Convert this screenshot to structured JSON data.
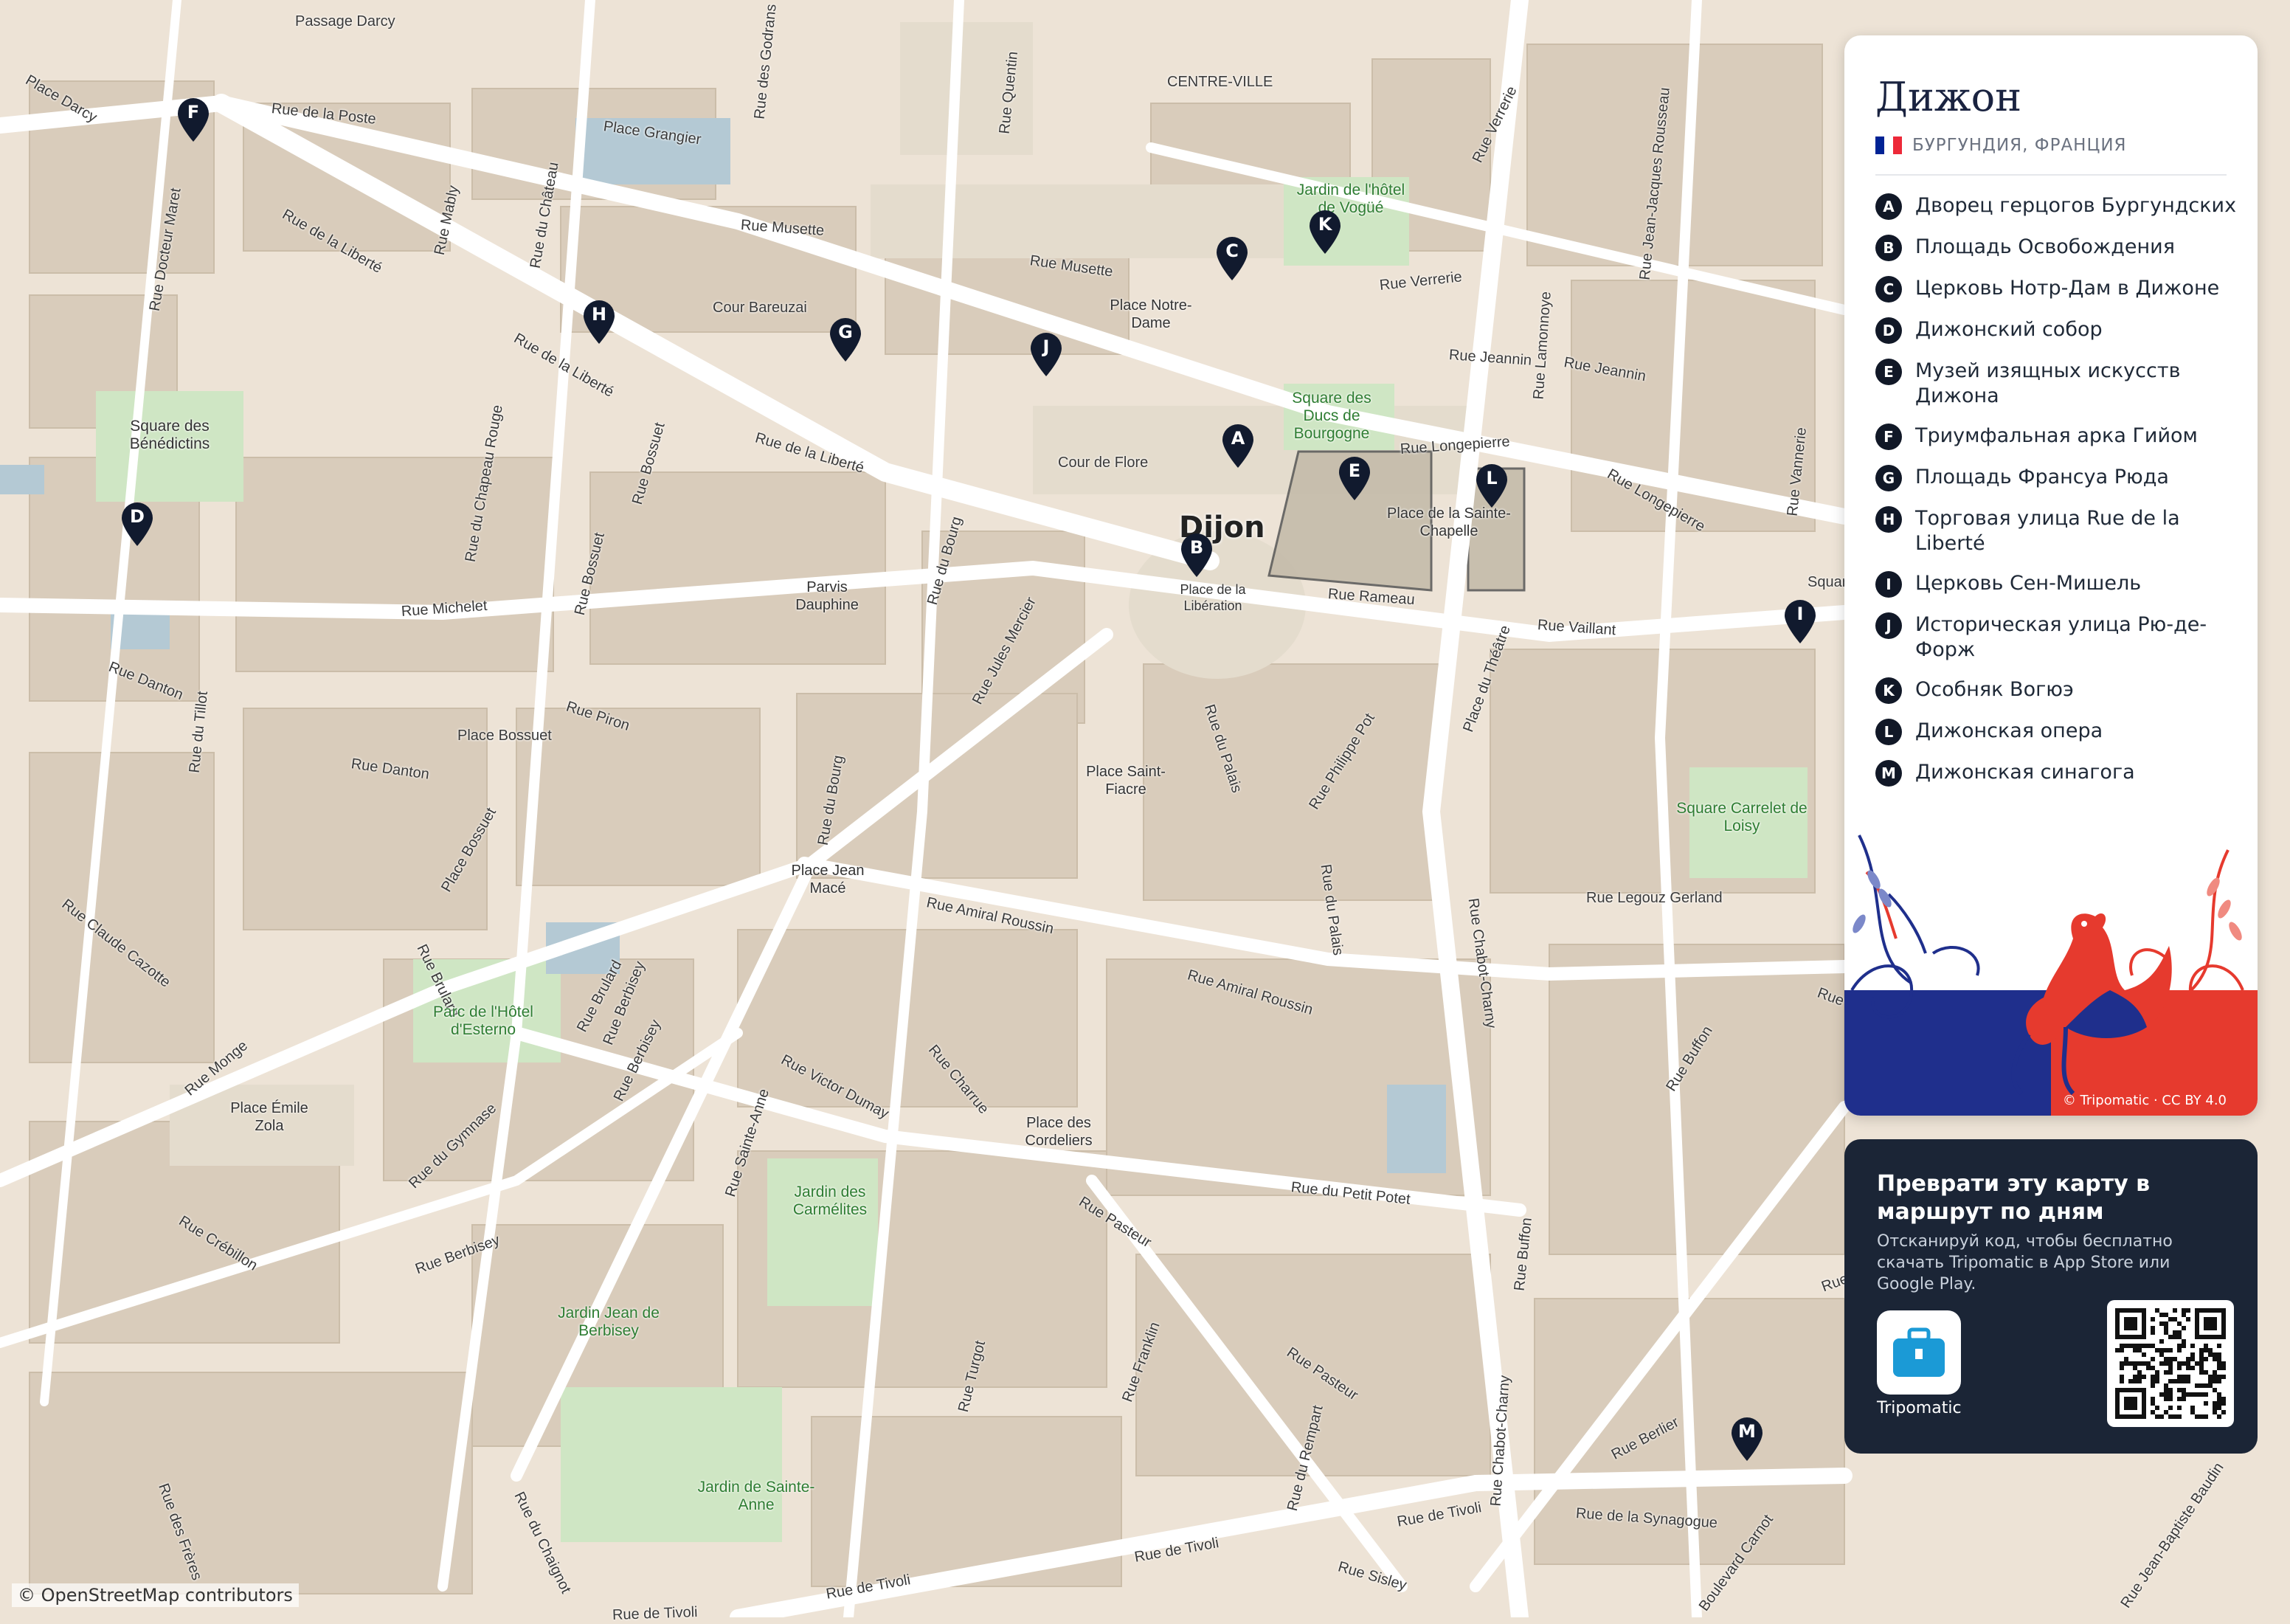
{
  "map": {
    "city_label": "Dijon",
    "attribution": "© OpenStreetMap contributors",
    "street_labels": [
      "Passage Darcy",
      "Place Darcy",
      "Rue de la Poste",
      "Place Grangier",
      "Rue des Godrans",
      "Rue Quentin",
      "CENTRE-VILLE",
      "Rue Verrerie",
      "Rue Jean-Jacques Rousseau",
      "Rue Docteur Maret",
      "Rue de la Liberté",
      "Rue Mably",
      "Rue du Château",
      "Rue Musette",
      "Rue Musette",
      "Cour Bareuzai",
      "Place Notre-Dame",
      "Rue Verrerie",
      "Rue Lamonnoye",
      "Rue Jeannin",
      "Rue Jeannin",
      "Rue de la Liberté",
      "Rue de la Liberté",
      "Rue Longepierre",
      "Rue Longepierre",
      "Cour de Flore",
      "Place de la Sainte-Chapelle",
      "Rue du Chapeau Rouge",
      "Rue Bossuet",
      "Rue Bossuet",
      "Rue du Bourg",
      "Rue Jules Mercier",
      "Parvis Dauphine",
      "Place de la Libération",
      "Rue Rameau",
      "Rue Vaillant",
      "Place du Théâtre",
      "Rue Michelet",
      "Rue Danton",
      "Rue du Tillot",
      "Rue Piron",
      "Place Bossuet",
      "Rue Danton",
      "Rue du Palais",
      "Rue Philippe Pot",
      "Place Saint-Fiacre",
      "Place Bossuet",
      "Rue du Bourg",
      "Place Jean Macé",
      "Rue Claude Cazotte",
      "Rue Amiral Roussin",
      "Rue Legouz Gerland",
      "Rue du Palais",
      "Rue Brulard",
      "Rue Brulard",
      "Rue Chabot-Charny",
      "Rue Amiral Roussin",
      "Rue Monge",
      "Rue Berbisey",
      "Rue Victor Dumay",
      "Rue Charrue",
      "Rue du Gymnase",
      "Place des Cordeliers",
      "Rue Buffon",
      "Rue Crébillon",
      "Rue Berbisey",
      "Rue Sainte-Anne",
      "Rue du Petit Potet",
      "Rue Pasteur",
      "Rue Buffon",
      "Rue Berbisey",
      "Rue Turgot",
      "Rue Franklin",
      "Rue Pasteur",
      "Rue Chabot-Charny",
      "Rue Berlier",
      "Rue du Rempart",
      "Rue de la Synagogue",
      "Rue du Chaignot",
      "Rue de Tivoli",
      "Rue de Tivoli",
      "Boulevard Carnot",
      "Rue Sisley",
      "Rue de Tivoli",
      "Rue de Tivoli",
      "Rue Jean-Baptiste Baudin",
      "Rue des Frères",
      "Rue Vannerie",
      "Rue Berlier",
      "Square",
      "Rue"
    ],
    "green_labels": [
      "Jardin de l'hôtel de Vogüé",
      "Square des Ducs de Bourgogne",
      "Square des Bénédictins",
      "Parc de l'Hôtel d'Esterno",
      "Jardin des Carmélites",
      "Jardin Jean de Berbisey",
      "Jardin de Sainte-Anne",
      "Square Carrelet de Loisy"
    ],
    "place_labels": [
      "Place Émile Zola"
    ],
    "markers": [
      "A",
      "B",
      "C",
      "D",
      "E",
      "F",
      "G",
      "H",
      "I",
      "J",
      "K",
      "L",
      "M"
    ]
  },
  "panel": {
    "title": "Дижон",
    "region": "БУРГУНДИЯ, ФРАНЦИЯ",
    "flag_colors": [
      "#002395",
      "#ffffff",
      "#ed2939"
    ],
    "poi": [
      {
        "letter": "A",
        "name": "Дворец герцогов Бургундских"
      },
      {
        "letter": "B",
        "name": "Площадь Освобождения"
      },
      {
        "letter": "C",
        "name": "Церковь Нотр-Дам в Дижоне"
      },
      {
        "letter": "D",
        "name": "Дижонский собор"
      },
      {
        "letter": "E",
        "name": "Музей изящных искусств Дижона"
      },
      {
        "letter": "F",
        "name": "Триумфальная арка Гийом"
      },
      {
        "letter": "G",
        "name": "Площадь Франсуа Рюда"
      },
      {
        "letter": "H",
        "name": "Торговая улица Rue de la Liberté"
      },
      {
        "letter": "I",
        "name": "Церковь Сен-Мишель"
      },
      {
        "letter": "J",
        "name": "Историческая улица Рю-де-Форж"
      },
      {
        "letter": "K",
        "name": "Особняк Вогюэ"
      },
      {
        "letter": "L",
        "name": "Дижонская опера"
      },
      {
        "letter": "M",
        "name": "Дижонская синагога"
      }
    ],
    "art_icon": "rooster-illustration",
    "art_credit": "© Tripomatic · CC BY 4.0"
  },
  "promo": {
    "title": "Преврати эту карту в маршрут по дням",
    "text": "Отсканируй код, чтобы бесплатно скачать Tripomatic в App Store или Google Play.",
    "app_icon": "suitcase-icon",
    "app_name": "Tripomatic",
    "qr_icon": "qr-code-icon"
  }
}
